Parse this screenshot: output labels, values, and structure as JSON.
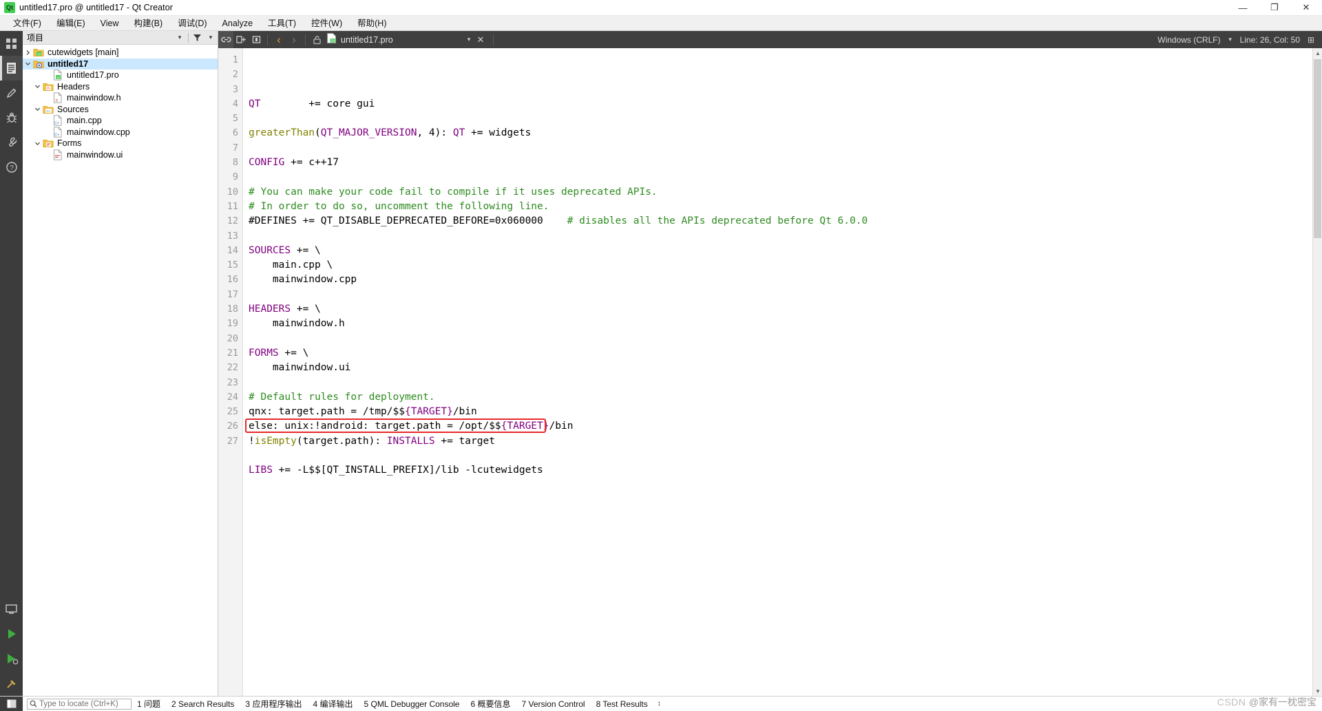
{
  "window": {
    "title": "untitled17.pro @ untitled17 - Qt Creator",
    "app_icon_label": "Qt",
    "minimize": "—",
    "maximize": "❐",
    "close": "✕"
  },
  "menubar": {
    "items": [
      {
        "label": "文件(F)",
        "name": "menu-file"
      },
      {
        "label": "编辑(E)",
        "name": "menu-edit"
      },
      {
        "label": "View",
        "name": "menu-view"
      },
      {
        "label": "构建(B)",
        "name": "menu-build"
      },
      {
        "label": "调试(D)",
        "name": "menu-debug"
      },
      {
        "label": "Analyze",
        "name": "menu-analyze"
      },
      {
        "label": "工具(T)",
        "name": "menu-tools"
      },
      {
        "label": "控件(W)",
        "name": "menu-widgets"
      },
      {
        "label": "帮助(H)",
        "name": "menu-help"
      }
    ]
  },
  "modebar": {
    "items": [
      {
        "name": "mode-welcome",
        "icon": "grid-icon",
        "active": false
      },
      {
        "name": "mode-edit",
        "icon": "document-icon",
        "active": true
      },
      {
        "name": "mode-design",
        "icon": "pencil-icon",
        "active": false
      },
      {
        "name": "mode-debug",
        "icon": "bug-icon",
        "active": false
      },
      {
        "name": "mode-projects",
        "icon": "wrench-icon",
        "active": false
      },
      {
        "name": "mode-help",
        "icon": "question-icon",
        "active": false
      }
    ],
    "bottom": [
      {
        "name": "kit-selector",
        "icon": "monitor-icon"
      },
      {
        "name": "run-button",
        "icon": "play-icon"
      },
      {
        "name": "debug-button",
        "icon": "debug-play-icon"
      },
      {
        "name": "build-button",
        "icon": "hammer-icon"
      }
    ]
  },
  "project_panel": {
    "title": "项目",
    "header_buttons": [
      {
        "name": "filter-dropdown-icon",
        "glyph": "▾"
      },
      {
        "name": "filter-icon",
        "glyph": "✇"
      }
    ],
    "tree": [
      {
        "name": "tree-item-cutewidgets",
        "label": "cutewidgets [main]",
        "indent": 0,
        "twist": "›",
        "icon": "qt-folder-icon",
        "selected": false
      },
      {
        "name": "tree-item-untitled17",
        "label": "untitled17",
        "indent": 0,
        "twist": "ˇ",
        "icon": "qt-project-folder-icon",
        "selected": true
      },
      {
        "name": "tree-item-untitled17-pro",
        "label": "untitled17.pro",
        "indent": 2,
        "twist": "",
        "icon": "qt-file-icon",
        "selected": false
      },
      {
        "name": "tree-item-headers",
        "label": "Headers",
        "indent": 1,
        "twist": "ˇ",
        "icon": "h-folder-icon",
        "selected": false
      },
      {
        "name": "tree-item-mainwindow-h",
        "label": "mainwindow.h",
        "indent": 2,
        "twist": "",
        "icon": "h-file-icon",
        "selected": false
      },
      {
        "name": "tree-item-sources",
        "label": "Sources",
        "indent": 1,
        "twist": "ˇ",
        "icon": "cpp-folder-icon",
        "selected": false
      },
      {
        "name": "tree-item-main-cpp",
        "label": "main.cpp",
        "indent": 2,
        "twist": "",
        "icon": "cpp-file-icon",
        "selected": false
      },
      {
        "name": "tree-item-mainwindow-cpp",
        "label": "mainwindow.cpp",
        "indent": 2,
        "twist": "",
        "icon": "cpp-file-icon",
        "selected": false
      },
      {
        "name": "tree-item-forms",
        "label": "Forms",
        "indent": 1,
        "twist": "ˇ",
        "icon": "ui-folder-icon",
        "selected": false
      },
      {
        "name": "tree-item-mainwindow-ui",
        "label": "mainwindow.ui",
        "indent": 2,
        "twist": "",
        "icon": "ui-file-icon",
        "selected": false
      }
    ]
  },
  "editor_toolbar": {
    "link_button": "link-icon",
    "split_button": "split-icon",
    "close_split_button": "close-split-icon",
    "nav_back": "‹",
    "nav_forward": "›",
    "lock_icon": "unlock-icon",
    "tab_name": "untitled17.pro",
    "tab_dropdown": "▾",
    "tab_close": "✕",
    "line_ending": "Windows (CRLF)",
    "encoding_dropdown": "▾",
    "cursor_position": "Line: 26, Col: 50",
    "split_editor": "⊞"
  },
  "code": {
    "first_line": 1,
    "last_line": 27,
    "highlight_line": 26,
    "lines": [
      {
        "n": 1,
        "tokens": [
          {
            "t": "QT",
            "c": "kw"
          },
          {
            "t": "        += core gui",
            "c": "op"
          }
        ]
      },
      {
        "n": 2,
        "tokens": []
      },
      {
        "n": 3,
        "tokens": [
          {
            "t": "greaterThan",
            "c": "fn"
          },
          {
            "t": "(",
            "c": "op"
          },
          {
            "t": "QT_MAJOR_VERSION",
            "c": "var"
          },
          {
            "t": ", 4): ",
            "c": "op"
          },
          {
            "t": "QT",
            "c": "var"
          },
          {
            "t": " += widgets",
            "c": "op"
          }
        ]
      },
      {
        "n": 4,
        "tokens": []
      },
      {
        "n": 5,
        "tokens": [
          {
            "t": "CONFIG",
            "c": "kw"
          },
          {
            "t": " += c++17",
            "c": "op"
          }
        ]
      },
      {
        "n": 6,
        "tokens": []
      },
      {
        "n": 7,
        "tokens": [
          {
            "t": "# You can make your code fail to compile if it uses deprecated APIs.",
            "c": "cmt"
          }
        ]
      },
      {
        "n": 8,
        "tokens": [
          {
            "t": "# In order to do so, uncomment the following line.",
            "c": "cmt"
          }
        ]
      },
      {
        "n": 9,
        "tokens": [
          {
            "t": "#DEFINES += QT_DISABLE_DEPRECATED_BEFORE=0x060000",
            "c": "op"
          },
          {
            "t": "    # disables all the APIs deprecated before Qt 6.0.0",
            "c": "cmt"
          }
        ]
      },
      {
        "n": 10,
        "tokens": []
      },
      {
        "n": 11,
        "tokens": [
          {
            "t": "SOURCES",
            "c": "kw"
          },
          {
            "t": " += \\",
            "c": "op"
          }
        ]
      },
      {
        "n": 12,
        "tokens": [
          {
            "t": "    main.cpp \\",
            "c": "op"
          }
        ]
      },
      {
        "n": 13,
        "tokens": [
          {
            "t": "    mainwindow.cpp",
            "c": "op"
          }
        ]
      },
      {
        "n": 14,
        "tokens": []
      },
      {
        "n": 15,
        "tokens": [
          {
            "t": "HEADERS",
            "c": "kw"
          },
          {
            "t": " += \\",
            "c": "op"
          }
        ]
      },
      {
        "n": 16,
        "tokens": [
          {
            "t": "    mainwindow.h",
            "c": "op"
          }
        ]
      },
      {
        "n": 17,
        "tokens": []
      },
      {
        "n": 18,
        "tokens": [
          {
            "t": "FORMS",
            "c": "kw"
          },
          {
            "t": " += \\",
            "c": "op"
          }
        ]
      },
      {
        "n": 19,
        "tokens": [
          {
            "t": "    mainwindow.ui",
            "c": "op"
          }
        ]
      },
      {
        "n": 20,
        "tokens": []
      },
      {
        "n": 21,
        "tokens": [
          {
            "t": "# Default rules for deployment.",
            "c": "cmt"
          }
        ]
      },
      {
        "n": 22,
        "tokens": [
          {
            "t": "qnx: target.path = /tmp/$$",
            "c": "op"
          },
          {
            "t": "{TARGET}",
            "c": "var"
          },
          {
            "t": "/bin",
            "c": "op"
          }
        ]
      },
      {
        "n": 23,
        "tokens": [
          {
            "t": "else: unix:!android: target.path = /opt/$$",
            "c": "op"
          },
          {
            "t": "{TARGET}",
            "c": "var"
          },
          {
            "t": "/bin",
            "c": "op"
          }
        ]
      },
      {
        "n": 24,
        "tokens": [
          {
            "t": "!",
            "c": "op"
          },
          {
            "t": "isEmpty",
            "c": "fn"
          },
          {
            "t": "(target.path): ",
            "c": "op"
          },
          {
            "t": "INSTALLS",
            "c": "kw"
          },
          {
            "t": " += target",
            "c": "op"
          }
        ]
      },
      {
        "n": 25,
        "tokens": []
      },
      {
        "n": 26,
        "tokens": [
          {
            "t": "LIBS",
            "c": "kw"
          },
          {
            "t": " += -L$$[QT_INSTALL_PREFIX]/lib -lcutewidgets",
            "c": "op"
          }
        ]
      },
      {
        "n": 27,
        "tokens": []
      }
    ]
  },
  "bottombar": {
    "locator_placeholder": "Type to locate (Ctrl+K)",
    "search-icon": "🔍",
    "tabs": [
      {
        "name": "output-tab-issues",
        "num": "1",
        "label": "问题"
      },
      {
        "name": "output-tab-search-results",
        "num": "2",
        "label": "Search Results"
      },
      {
        "name": "output-tab-app-output",
        "num": "3",
        "label": "应用程序输出"
      },
      {
        "name": "output-tab-compile-output",
        "num": "4",
        "label": "编译输出"
      },
      {
        "name": "output-tab-qml-debugger",
        "num": "5",
        "label": "QML Debugger Console"
      },
      {
        "name": "output-tab-general-messages",
        "num": "6",
        "label": "概要信息"
      },
      {
        "name": "output-tab-version-control",
        "num": "7",
        "label": "Version Control"
      },
      {
        "name": "output-tab-test-results",
        "num": "8",
        "label": "Test Results"
      }
    ],
    "updown": "↕"
  },
  "watermark": {
    "prefix": "CSDN ",
    "text": "@家有一枕密宝"
  },
  "colors": {
    "accent_selection": "#cce8ff",
    "keyword": "#800080",
    "comment": "#2e8b20",
    "function": "#808000",
    "red_box": "#e8282a",
    "toolbar_dark": "#3f3f3f",
    "modebar_dark": "#3c3c3c"
  }
}
